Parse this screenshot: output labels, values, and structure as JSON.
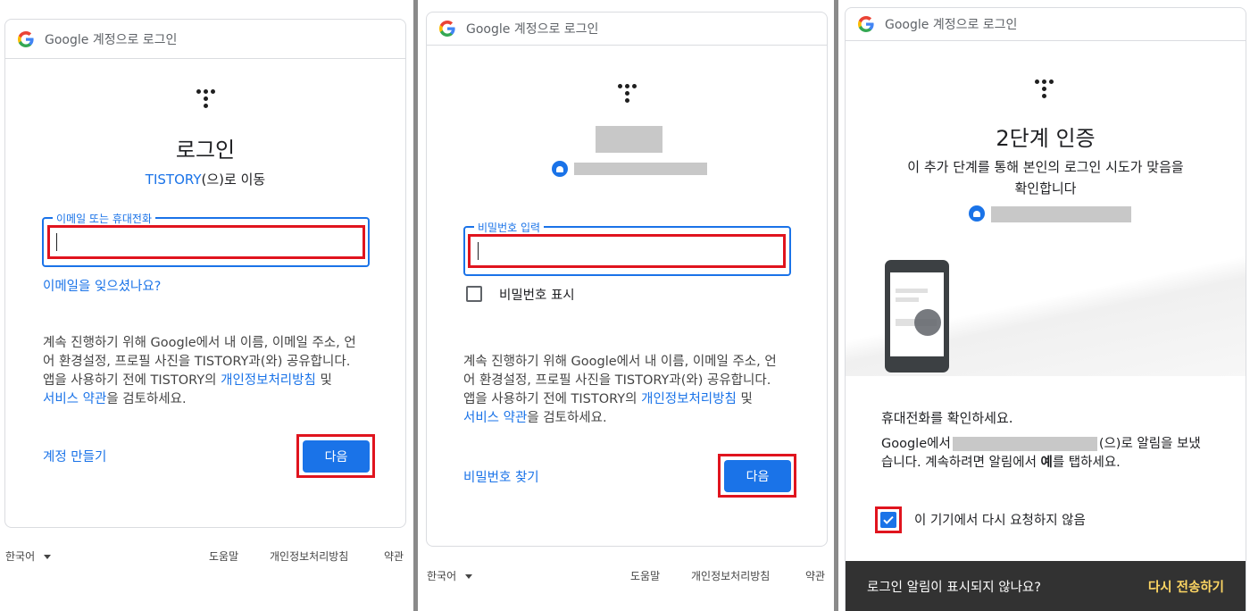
{
  "panels": {
    "p1": {
      "header": "Google 계정으로 로그인",
      "title": "로그인",
      "subtitle_app": "TISTORY",
      "subtitle_rest": "(으)로 이동",
      "email_label": "이메일 또는 휴대전화",
      "forgot_email": "이메일을 잊으셨나요?",
      "consent_line1": "계속 진행하기 위해 Google에서 내 이름, 이메일 주소, 언",
      "consent_line2": "어 환경설정, 프로필 사진을 TISTORY과(와) 공유합니다.",
      "consent_line3a": "앱을 사용하기 전에 TISTORY의 ",
      "privacy_link": "개인정보처리방침",
      "consent_line3b": " 및",
      "terms_link": "서비스 약관",
      "consent_line4b": "을 검토하세요.",
      "create_account": "계정 만들기",
      "next": "다음"
    },
    "p2": {
      "header": "Google 계정으로 로그인",
      "password_label": "비밀번호 입력",
      "show_password": "비밀번호 표시",
      "consent_line1": "계속 진행하기 위해 Google에서 내 이름, 이메일 주소, 언",
      "consent_line2": "어 환경설정, 프로필 사진을 TISTORY과(와) 공유합니다.",
      "consent_line3a": "앱을 사용하기 전에 TISTORY의 ",
      "privacy_link": "개인정보처리방침",
      "consent_line3b": " 및",
      "terms_link": "서비스 약관",
      "consent_line4b": "을 검토하세요.",
      "find_password": "비밀번호 찾기",
      "next": "다음"
    },
    "p3": {
      "header": "Google 계정으로 로그인",
      "title": "2단계 인증",
      "desc_line1": "이 추가 단계를 통해 본인의 로그인 시도가 맞음을",
      "desc_line2": "확인합니다",
      "check_phone": "휴대전화를 확인하세요.",
      "notice_a": "Google에서",
      "notice_b": "(으)로 알림을 보냈",
      "notice_c": "습니다. 계속하려면 알림에서 ",
      "notice_yes": "예",
      "notice_d": "를 탭하세요.",
      "dont_ask": "이 기기에서 다시 요청하지 않음",
      "snackbar_text": "로그인 알림이 표시되지 않나요?",
      "resend": "다시 전송하기"
    }
  },
  "footer": {
    "language": "한국어",
    "help": "도움말",
    "privacy": "개인정보처리방침",
    "terms": "약관"
  },
  "colors": {
    "accent": "#1a73e8",
    "highlight": "#e0141e",
    "resend": "#fdd663"
  }
}
